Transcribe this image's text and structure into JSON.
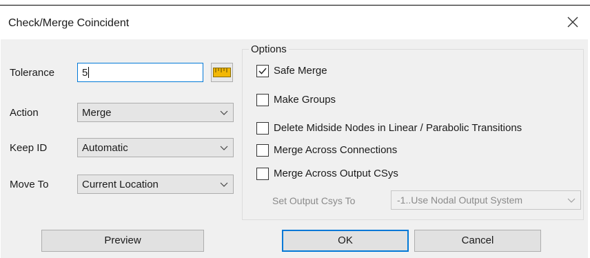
{
  "window": {
    "title": "Check/Merge Coincident"
  },
  "fields": {
    "tolerance": {
      "label": "Tolerance",
      "value": "5"
    },
    "action": {
      "label": "Action",
      "value": "Merge"
    },
    "keep_id": {
      "label": "Keep ID",
      "value": "Automatic"
    },
    "move_to": {
      "label": "Move To",
      "value": "Current Location"
    }
  },
  "options": {
    "caption": "Options",
    "checkboxes": [
      {
        "label": "Safe Merge",
        "checked": true
      },
      {
        "label": "Make Groups",
        "checked": false
      },
      {
        "label": "Delete Midside Nodes in Linear / Parabolic Transitions",
        "checked": false
      },
      {
        "label": "Merge Across Connections",
        "checked": false
      },
      {
        "label": "Merge Across Output CSys",
        "checked": false
      }
    ],
    "output_csys": {
      "label": "Set Output Csys To",
      "value": "-1..Use Nodal Output System",
      "enabled": false
    }
  },
  "buttons": {
    "preview": "Preview",
    "ok": "OK",
    "cancel": "Cancel"
  },
  "colors": {
    "focus_accent": "#0078d7",
    "ruler_icon": "#f2b705"
  }
}
